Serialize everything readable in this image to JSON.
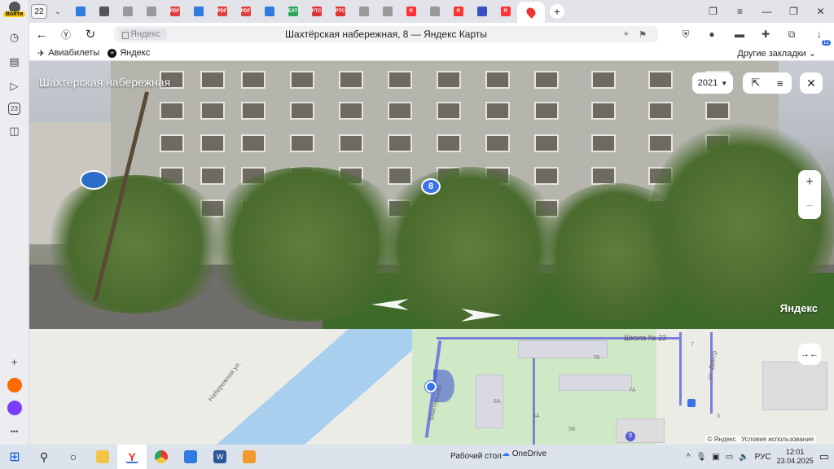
{
  "browser": {
    "left_bar": {
      "login_label": "Войти",
      "history_badge": "23"
    },
    "tab_count": "22",
    "tabs": [
      {
        "icon": "cloud-icon",
        "color": "#2f7be0",
        "text": ""
      },
      {
        "icon": "doc-icon",
        "color": "#555555",
        "text": ""
      },
      {
        "icon": "page-icon",
        "color": "#999999",
        "text": ""
      },
      {
        "icon": "page-icon",
        "color": "#999999",
        "text": ""
      },
      {
        "icon": "pdf-icon",
        "color": "#e04040",
        "text": "PDF"
      },
      {
        "icon": "mail-icon",
        "color": "#2f7be0",
        "text": ""
      },
      {
        "icon": "pdf-icon",
        "color": "#e04040",
        "text": "PDF"
      },
      {
        "icon": "pdf-icon",
        "color": "#e04040",
        "text": "PDF"
      },
      {
        "icon": "mail-icon",
        "color": "#2f7be0",
        "text": ""
      },
      {
        "icon": "eat-icon",
        "color": "#2aa35a",
        "text": "EAT"
      },
      {
        "icon": "rtc-icon",
        "color": "#d33",
        "text": "РТС"
      },
      {
        "icon": "rtc-icon",
        "color": "#d33",
        "text": "РТС"
      },
      {
        "icon": "page-icon",
        "color": "#999999",
        "text": ""
      },
      {
        "icon": "page-icon",
        "color": "#999999",
        "text": ""
      },
      {
        "icon": "yandex-icon",
        "color": "#f33",
        "text": "Я"
      },
      {
        "icon": "page-icon",
        "color": "#999999",
        "text": ""
      },
      {
        "icon": "yandex-icon",
        "color": "#f33",
        "text": "Я"
      },
      {
        "icon": "gem-icon",
        "color": "#3a4fc4",
        "text": ""
      },
      {
        "icon": "yandex-icon",
        "color": "#f33",
        "text": "Я"
      }
    ],
    "active_tab_icon": "map-pin-icon",
    "address": {
      "host": "Яндекс",
      "page_title": "Шахтёрская набережная, 8 — Яндекс Карты"
    },
    "downloads_badge": "11",
    "bookmarks": [
      {
        "icon": "plane-icon",
        "label": "Авиабилеты"
      },
      {
        "icon": "yandex-plus-icon",
        "label": "Яндекс"
      }
    ],
    "other_bookmarks": "Другие закладки"
  },
  "panorama": {
    "title": "Шахтёрская набережная",
    "year": "2021",
    "house_marker": "8",
    "brand": "Яндекс"
  },
  "map": {
    "street_1": "Набережная ул.",
    "street_2": "Шахтёрская",
    "street_3": "ул. Дмитр",
    "school": "Школа № 23",
    "house_numbers": [
      "7Б",
      "8А",
      "8А",
      "7А",
      "5Б",
      "7",
      "3"
    ],
    "copyright": "© Яндекс",
    "terms": "Условия использования"
  },
  "taskbar": {
    "desktop_label": "Рабочий стол",
    "onedrive_label": "OneDrive",
    "lang": "РУС",
    "time": "12:01",
    "date": "23.04.2025"
  }
}
